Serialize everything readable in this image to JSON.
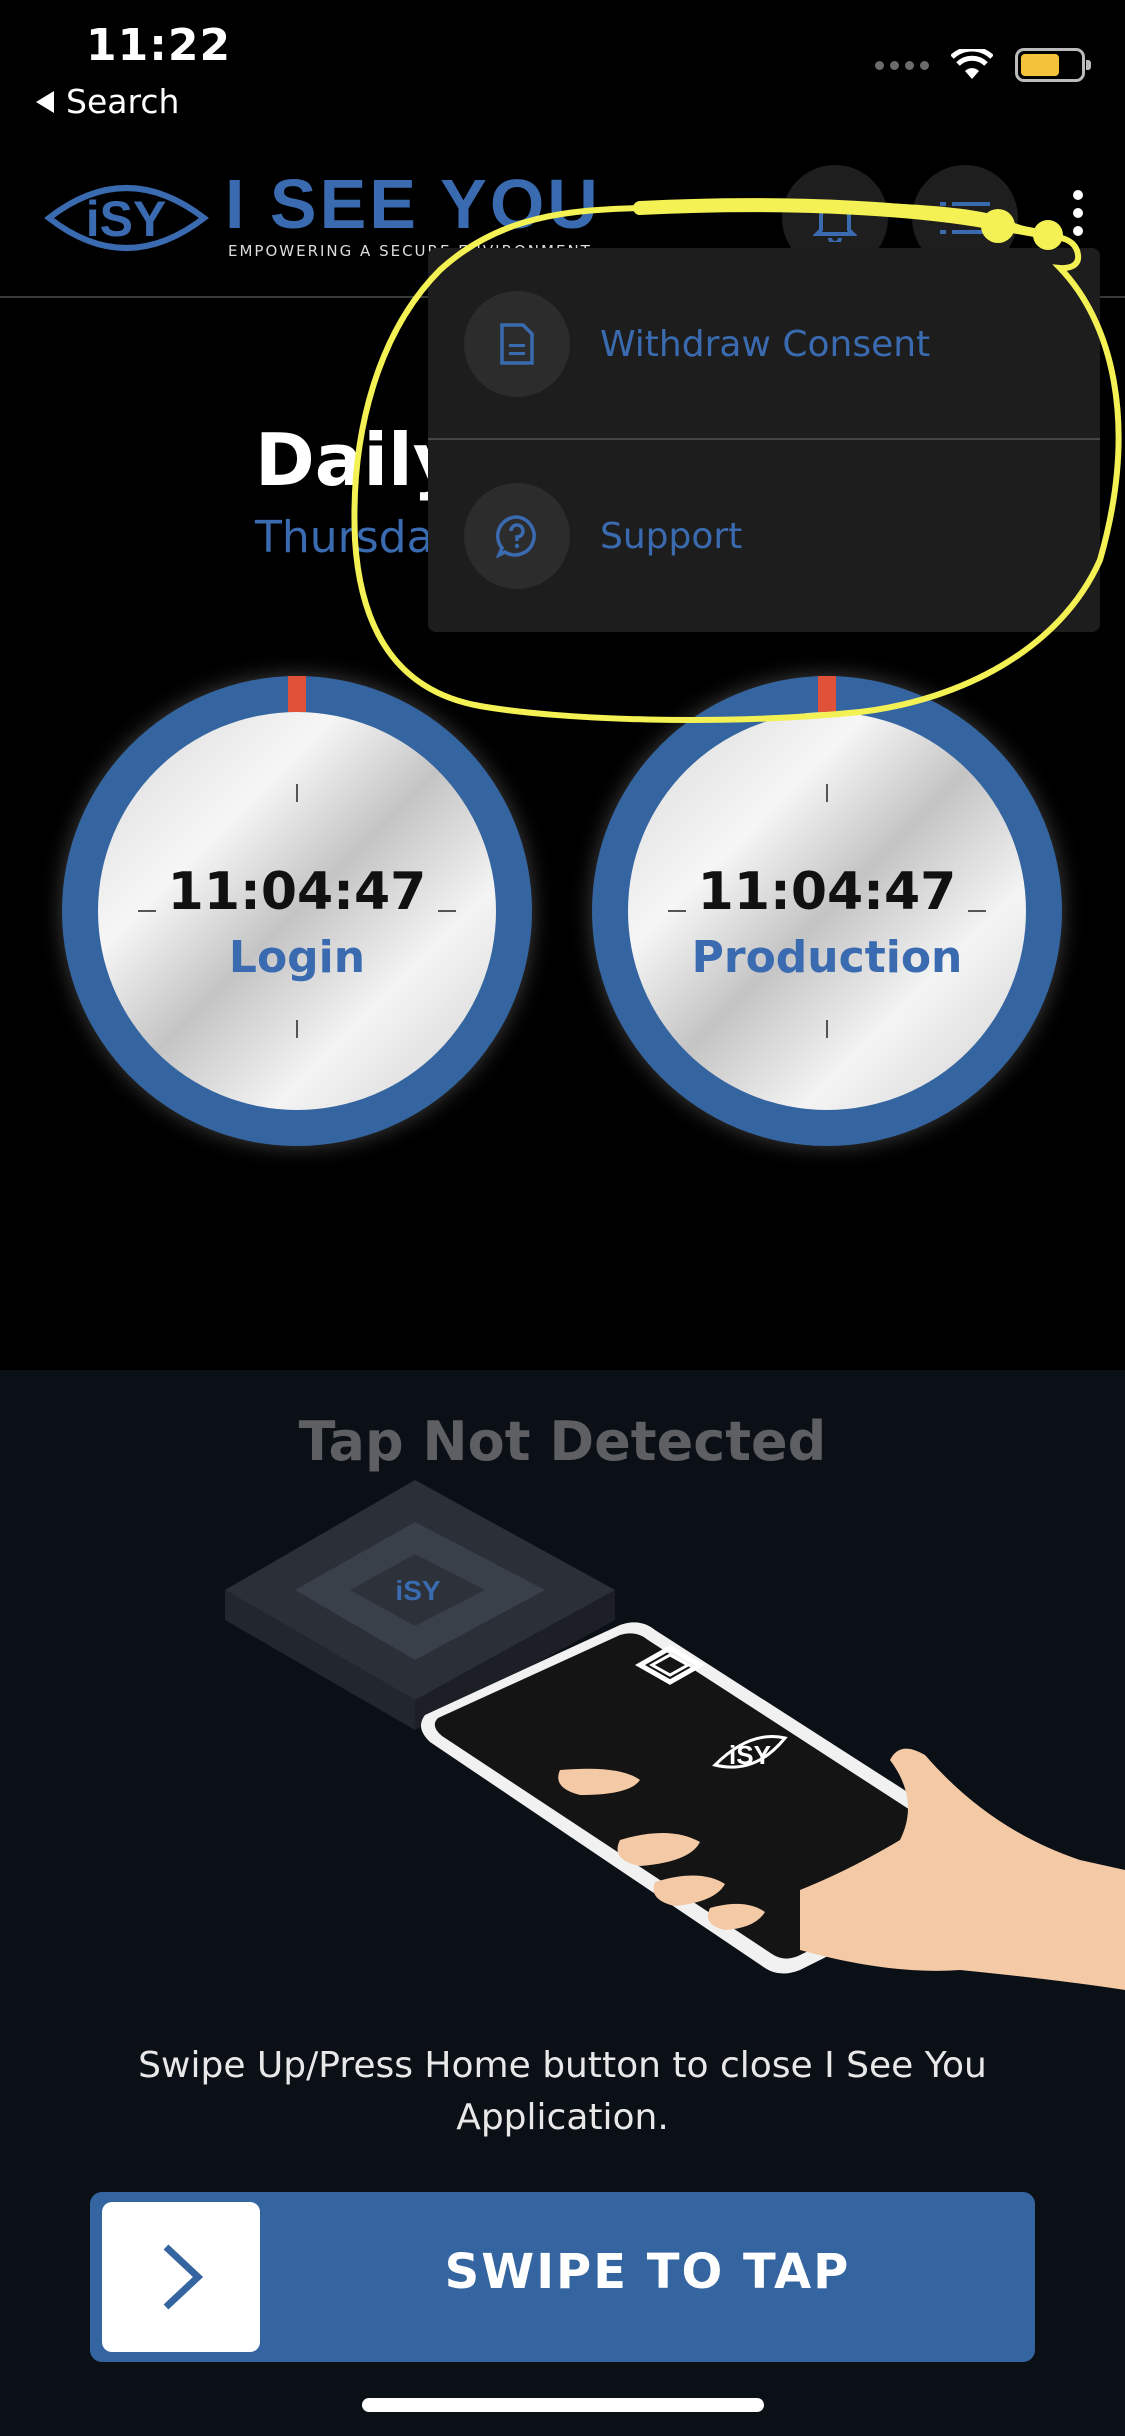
{
  "status_bar": {
    "time": "11:22",
    "back_label": "Search"
  },
  "header": {
    "logo_text": "iSY",
    "brand": "I SEE YOU",
    "tagline": "EMPOWERING A SECURE ENVIRONMENT",
    "icons": [
      "bell-icon",
      "list-icon",
      "more-vertical-icon"
    ]
  },
  "page": {
    "title": "Daily",
    "subtitle": "Thursda"
  },
  "dials": [
    {
      "time": "11:04:47",
      "label": "Login"
    },
    {
      "time": "11:04:47",
      "label": "Production"
    }
  ],
  "menu": {
    "items": [
      {
        "label": "Withdraw Consent",
        "icon": "document-icon"
      },
      {
        "label": "Support",
        "icon": "help-circle-icon"
      }
    ]
  },
  "tap": {
    "status": "Tap Not Detected",
    "instructions": "Swipe Up/Press Home button to close I See You Application.",
    "swipe_label": "SWIPE TO TAP"
  },
  "colors": {
    "accent": "#3565a0",
    "annotation": "#f3f154",
    "marker": "#e0513a"
  }
}
